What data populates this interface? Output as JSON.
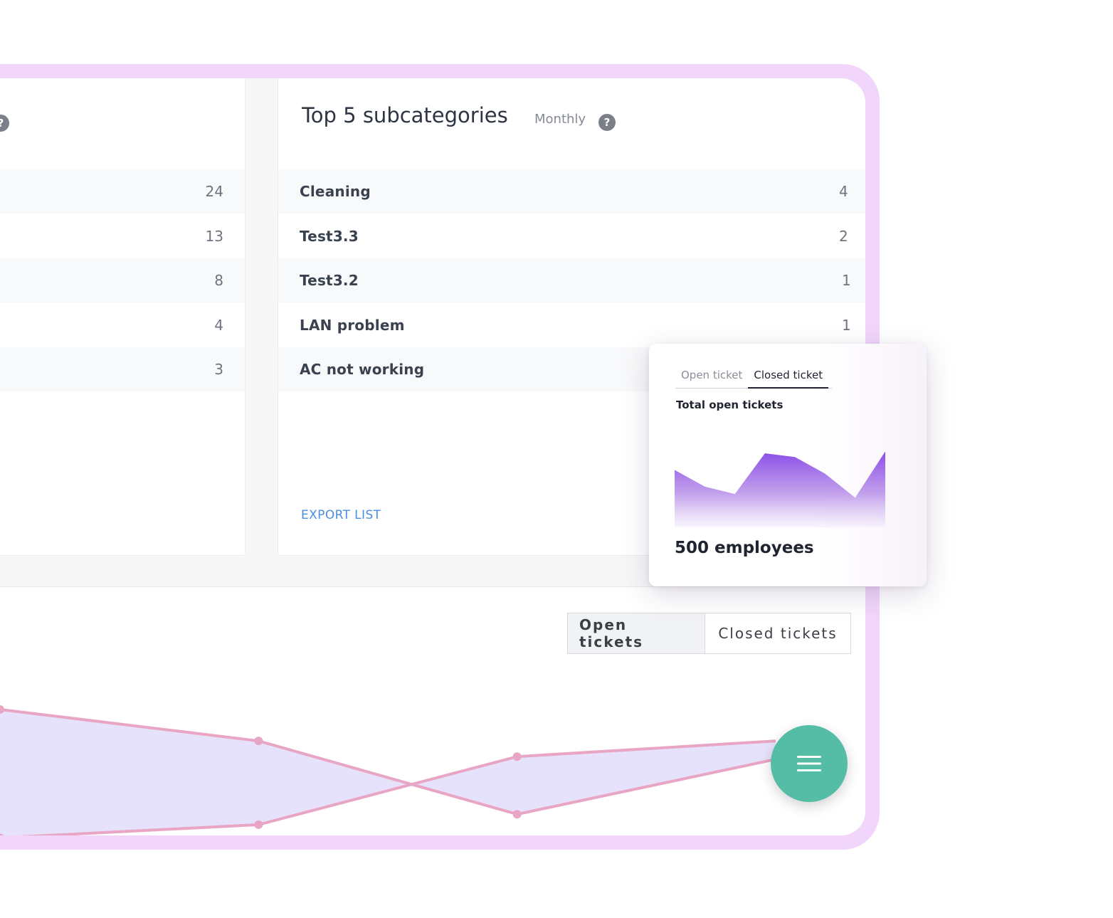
{
  "left_panel": {
    "values": [
      "24",
      "13",
      "8",
      "4",
      "3"
    ]
  },
  "subcategories_panel": {
    "title": "Top 5 subcategories",
    "period": "Monthly",
    "help_icon": "question-circle-icon",
    "rows": [
      {
        "name": "Cleaning",
        "count": "4"
      },
      {
        "name": "Test3.3",
        "count": "2"
      },
      {
        "name": "Test3.2",
        "count": "1"
      },
      {
        "name": "LAN problem",
        "count": "1"
      },
      {
        "name": "AC not working",
        "count": ""
      }
    ],
    "export_label": "EXPORT LIST"
  },
  "bottom_section": {
    "toggle": {
      "open_label": "Open tickets",
      "closed_label": "Closed tickets",
      "active": "open"
    }
  },
  "popup": {
    "tabs": {
      "open_label": "Open ticket",
      "closed_label": "Closed ticket",
      "active": "closed"
    },
    "subtitle": "Total open tickets",
    "stat": "500 employees"
  },
  "fab": {
    "icon": "menu-icon",
    "color": "#55bca5"
  },
  "colors": {
    "device_frame": "#f1d5fb",
    "accent_link": "#4a8ee0",
    "popup_chart": "#8a4de8",
    "line_chart": "#e8a6c4",
    "line_area": "#e7e2fb"
  },
  "chart_data": [
    {
      "type": "area",
      "x": [
        0,
        1,
        2,
        3,
        4,
        5,
        6,
        7
      ],
      "values": [
        62,
        44,
        36,
        80,
        76,
        58,
        32,
        82
      ],
      "ylim": [
        0,
        100
      ],
      "grid": false
    },
    {
      "type": "line",
      "series": [
        {
          "values": [
            2,
            12,
            64,
            76
          ]
        },
        {
          "values": [
            100,
            76,
            20,
            62
          ]
        }
      ],
      "grid": false
    }
  ]
}
